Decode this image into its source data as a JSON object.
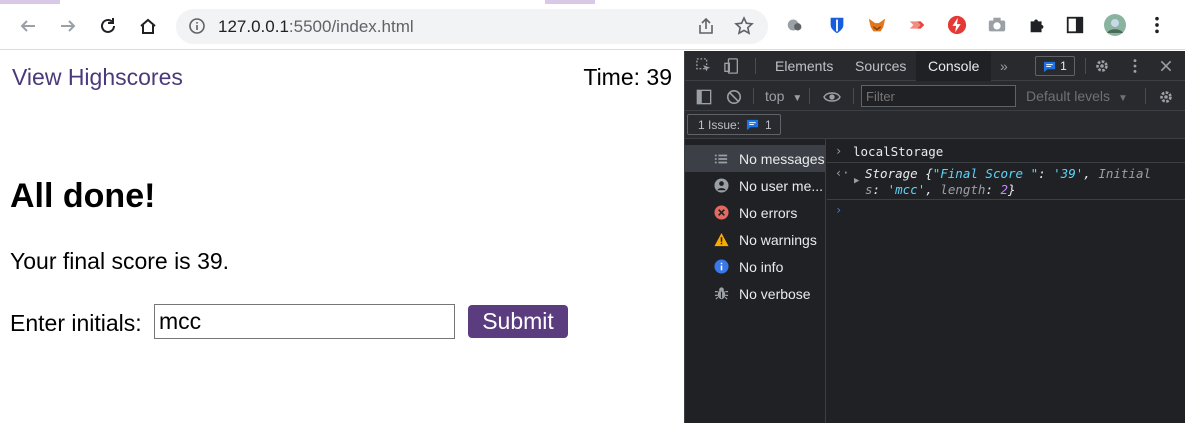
{
  "browser": {
    "url_host": "127.0.0.1",
    "url_path": ":5500/index.html",
    "accent": "#d9c9e6"
  },
  "page": {
    "highscores_link": "View Highscores",
    "time_label": "Time: 39",
    "heading": "All done!",
    "final_score_text": "Your final score is 39.",
    "initials_label": "Enter initials:",
    "initials_value": "mcc",
    "submit_label": "Submit",
    "link_color": "#4a3a7a",
    "button_color": "#5b3d7f"
  },
  "devtools": {
    "tabs": [
      "Elements",
      "Sources",
      "Console"
    ],
    "active_tab": "Console",
    "issues_badge": "1",
    "context": "top",
    "filter_placeholder": "Filter",
    "levels": "Default levels",
    "issues_pill_label": "1 Issue:",
    "issues_pill_count": "1",
    "sidebar": [
      {
        "icon": "list-icon",
        "label": "No messages"
      },
      {
        "icon": "user-icon",
        "label": "No user me..."
      },
      {
        "icon": "error-icon",
        "label": "No errors"
      },
      {
        "icon": "warning-icon",
        "label": "No warnings"
      },
      {
        "icon": "info-icon",
        "label": "No info"
      },
      {
        "icon": "bug-icon",
        "label": "No verbose"
      }
    ],
    "console": {
      "input": "localStorage",
      "output_line1_prefix": "Storage {",
      "output_key1": "\"Final Score \"",
      "output_val1": "'39'",
      "output_key2_part1": "Initial",
      "output_key2_part2": "s",
      "output_val2": "'mcc'",
      "output_key3": "length",
      "output_val3": "2"
    }
  }
}
